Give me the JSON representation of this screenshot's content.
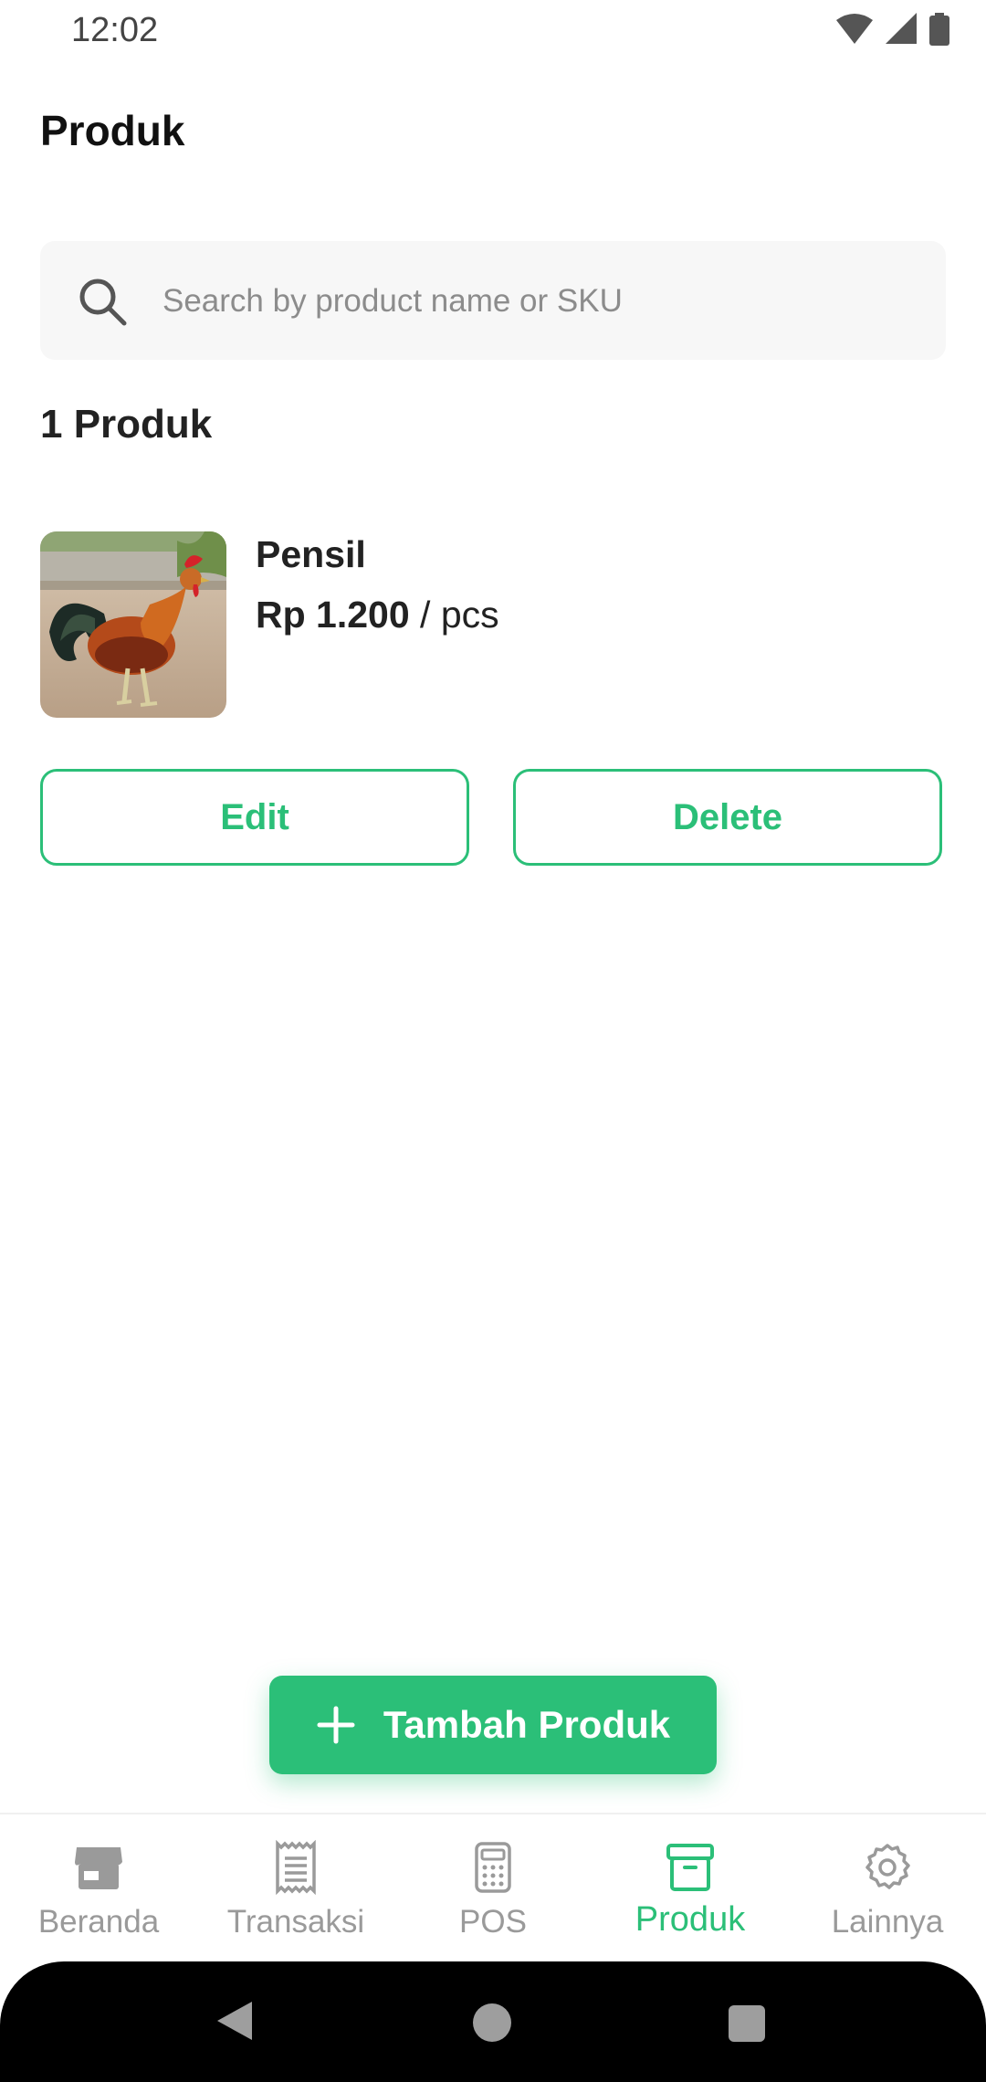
{
  "status_bar": {
    "time": "12:02"
  },
  "header": {
    "title": "Produk"
  },
  "search": {
    "placeholder": "Search by product name or SKU",
    "value": ""
  },
  "product_count": "1 Produk",
  "products": [
    {
      "name": "Pensil",
      "price": "Rp 1.200",
      "unit": " / pcs",
      "edit_label": "Edit",
      "delete_label": "Delete"
    }
  ],
  "fab": {
    "label": "Tambah Produk"
  },
  "bottom_nav": {
    "items": [
      {
        "label": "Beranda",
        "icon": "store-icon"
      },
      {
        "label": "Transaksi",
        "icon": "receipt-icon"
      },
      {
        "label": "POS",
        "icon": "calculator-icon"
      },
      {
        "label": "Produk",
        "icon": "archive-box-icon",
        "active": true
      },
      {
        "label": "Lainnya",
        "icon": "gear-icon"
      }
    ]
  },
  "colors": {
    "accent": "#2bbf78",
    "inactive": "#9a9a9a",
    "search_bg": "#f7f7f7"
  }
}
